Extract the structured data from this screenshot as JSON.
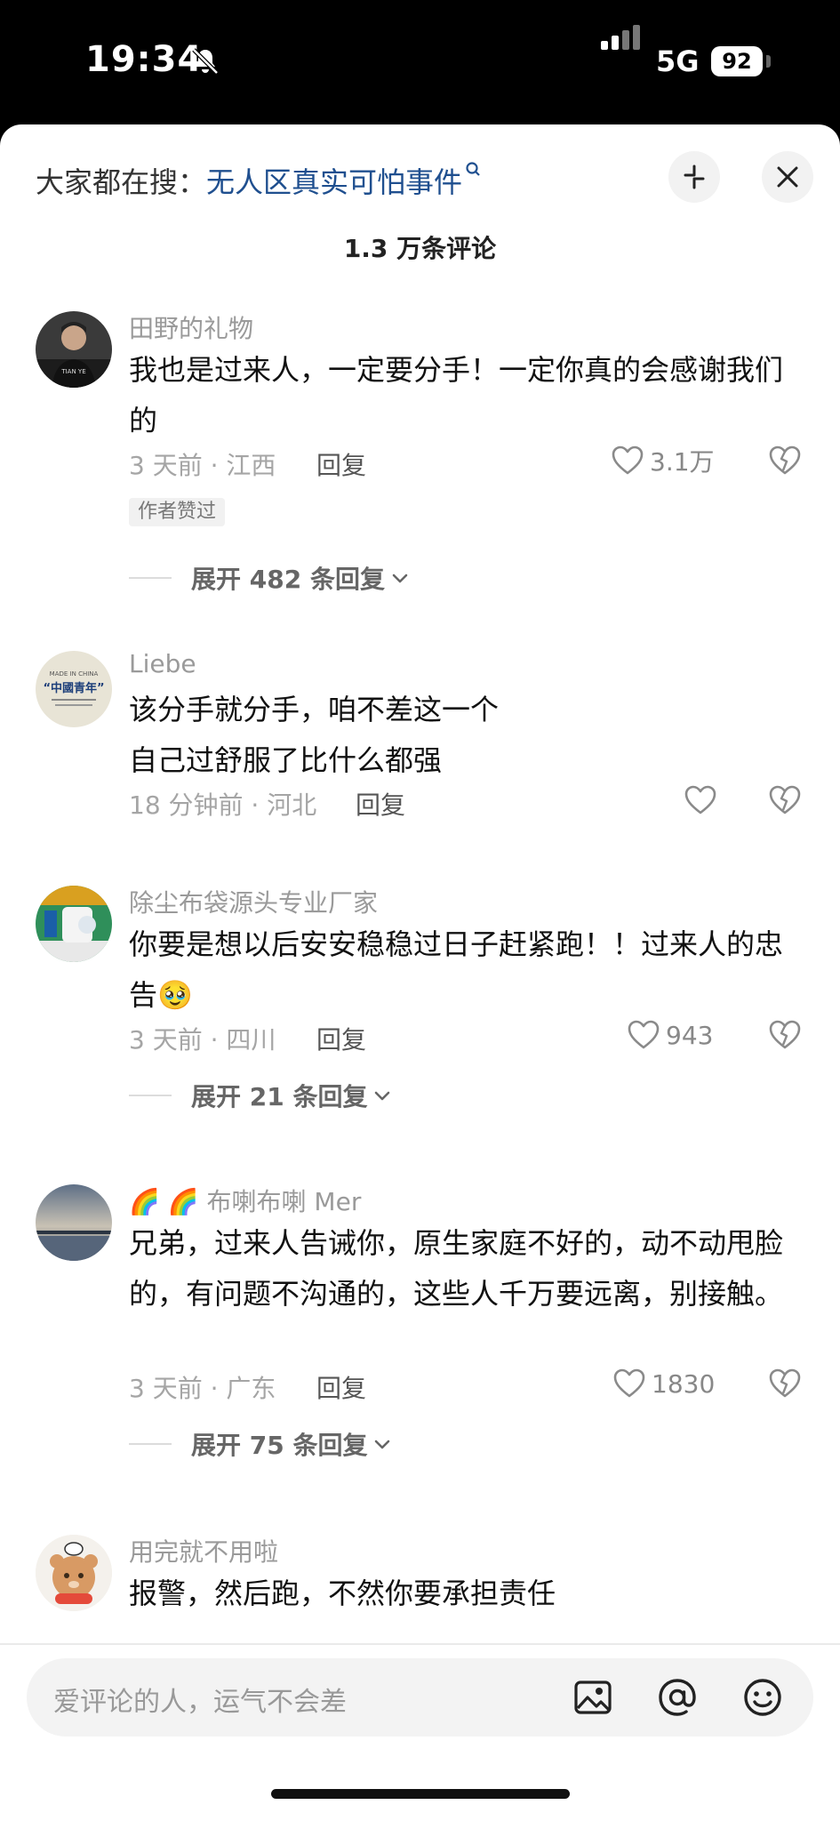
{
  "status_bar": {
    "time": "19:34",
    "network": "5G",
    "battery": "92",
    "icons": [
      "bell-muted-icon",
      "signal-bars-icon",
      "battery-icon"
    ]
  },
  "header": {
    "search_prefix": "大家都在搜：",
    "search_term": "无人区真实可怕事件",
    "comment_count": "1.3 万条评论",
    "icons": [
      "search-icon",
      "minimize-icon",
      "close-icon"
    ]
  },
  "comments": [
    {
      "username": "田野的礼物",
      "text": "我也是过来人，一定要分手！一定你真的会感谢我们的",
      "time_location": "3 天前 · 江西",
      "reply_label": "回复",
      "likes": "3.1万",
      "author_liked_label": "作者赞过",
      "expand_label": "展开 482 条回复"
    },
    {
      "username": "Liebe",
      "text": "该分手就分手，咱不差这一个\n自己过舒服了比什么都强",
      "time_location": "18 分钟前 · 河北",
      "reply_label": "回复",
      "likes": ""
    },
    {
      "username": "除尘布袋源头专业厂家",
      "text": "你要是想以后安安稳稳过日子赶紧跑！！过来人的忠告",
      "emoji": "🥹",
      "time_location": "3 天前 · 四川",
      "reply_label": "回复",
      "likes": "943",
      "expand_label": "展开 21 条回复"
    },
    {
      "username": "🌈 🌈 布喇布喇 Mer",
      "text": "兄弟，过来人告诫你，原生家庭不好的，动不动甩脸的，有问题不沟通的，这些人千万要远离，别接触。",
      "time_location": "3 天前 · 广东",
      "reply_label": "回复",
      "likes": "1830",
      "expand_label": "展开 75 条回复"
    },
    {
      "username": "用完就不用啦",
      "text": "报警，然后跑，不然你要承担责任"
    }
  ],
  "input_bar": {
    "placeholder": "爱评论的人，运气不会差",
    "icons": [
      "image-icon",
      "at-icon",
      "emoji-icon"
    ]
  },
  "avatar_texts": {
    "avatar1": "TIAN YE",
    "avatar2_top": "MADE IN CHINA",
    "avatar2_main": "“中國青年”"
  },
  "colors": {
    "link": "#1f4f8f",
    "meta": "#a5a5a5",
    "text": "#111111"
  }
}
